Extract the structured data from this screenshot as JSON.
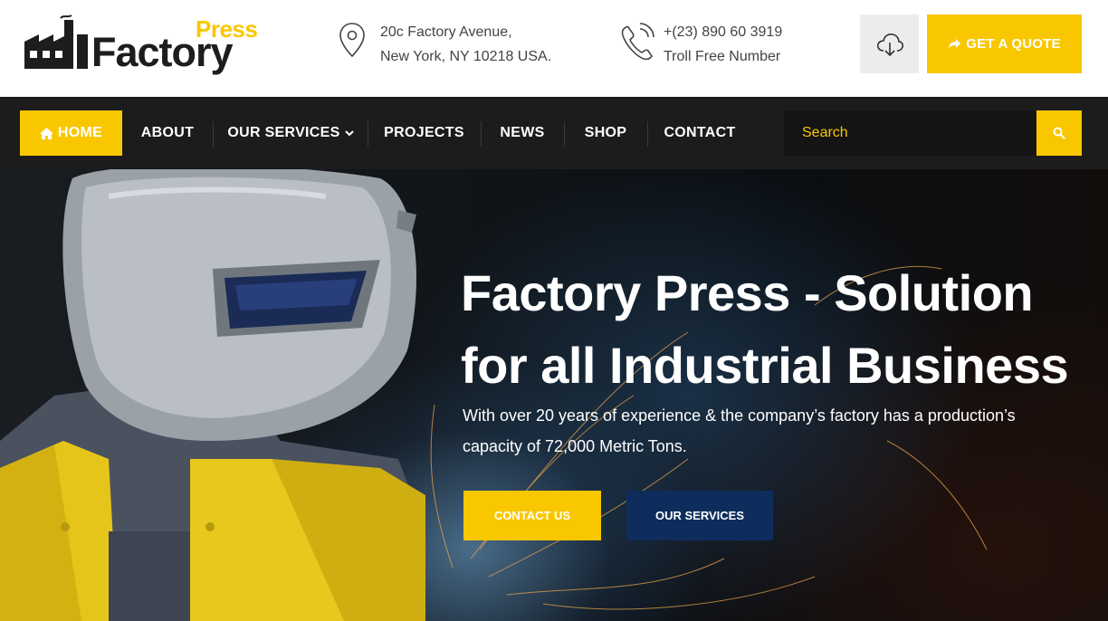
{
  "brand": {
    "logo_top": "Press",
    "logo_main": "Factory",
    "accent_color": "#f9c700",
    "dark_color": "#1c1c1c",
    "secondary_button_color": "#0e2d5c"
  },
  "header": {
    "address_icon": "map-pin-icon",
    "address_line1": "20c Factory Avenue,",
    "address_line2": "New York, NY 10218 USA.",
    "phone_icon": "phone-icon",
    "phone_line1": "+(23) 890 60 3919",
    "phone_line2": "Troll Free Number",
    "download_icon": "cloud-download-icon",
    "quote_icon": "share-arrow-icon",
    "quote_label": "GET A QUOTE"
  },
  "nav": {
    "items": [
      {
        "label": "HOME",
        "icon": "home-icon",
        "active": true
      },
      {
        "label": "ABOUT"
      },
      {
        "label": "OUR SERVICES",
        "icon": "chevron-down-icon"
      },
      {
        "label": "PROJECTS"
      },
      {
        "label": "NEWS"
      },
      {
        "label": "SHOP"
      },
      {
        "label": "CONTACT"
      }
    ],
    "search_placeholder": "Search",
    "search_icon": "search-icon"
  },
  "hero": {
    "title_line1": "Factory Press - Solution",
    "title_line2": "for all Industrial Business",
    "subtitle_line1": "With over 20 years of experience & the company’s factory has a production’s",
    "subtitle_line2": "capacity of 72,000 Metric Tons.",
    "primary_button": "CONTACT US",
    "secondary_button": "OUR SERVICES"
  }
}
